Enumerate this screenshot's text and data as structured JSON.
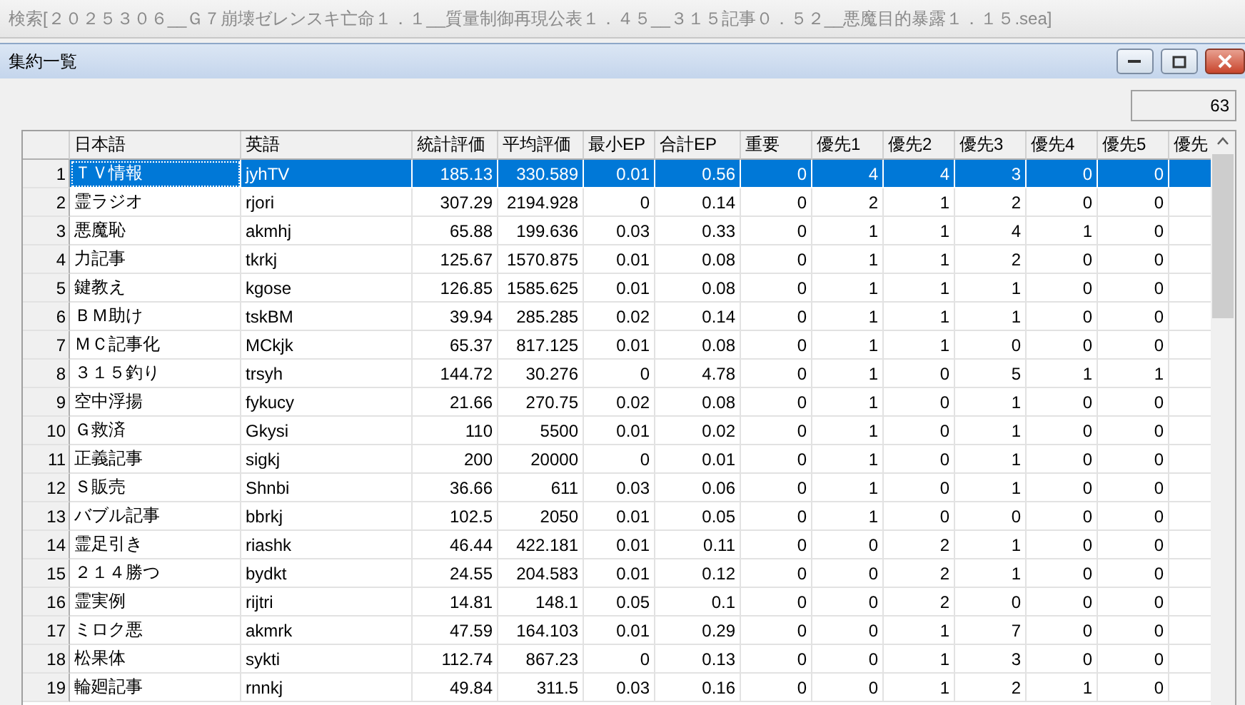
{
  "app_title": "検索[２０２５３０６__Ｇ７崩壊ゼレンスキ亡命１．１__質量制御再現公表１．４５__３１５記事０．５２__悪魔目的暴露１．１５.sea]",
  "window": {
    "title": "集約一覧"
  },
  "count": "63",
  "table": {
    "columns": [
      {
        "label": "日本語",
        "kind": "text"
      },
      {
        "label": "英語",
        "kind": "text"
      },
      {
        "label": "統計評価",
        "kind": "number"
      },
      {
        "label": "平均評価",
        "kind": "number"
      },
      {
        "label": "最小EP",
        "kind": "number"
      },
      {
        "label": "合計EP",
        "kind": "number"
      },
      {
        "label": "重要",
        "kind": "number"
      },
      {
        "label": "優先1",
        "kind": "number"
      },
      {
        "label": "優先2",
        "kind": "number"
      },
      {
        "label": "優先3",
        "kind": "number"
      },
      {
        "label": "優先4",
        "kind": "number"
      },
      {
        "label": "優先5",
        "kind": "number"
      },
      {
        "label": "優先",
        "kind": "number"
      }
    ],
    "rows": [
      {
        "number": "1",
        "selected": true,
        "cells": [
          "ＴＶ情報",
          "jyhTV",
          "185.13",
          "330.589",
          "0.01",
          "0.56",
          "0",
          "4",
          "4",
          "3",
          "0",
          "0"
        ]
      },
      {
        "number": "2",
        "selected": false,
        "cells": [
          "霊ラジオ",
          "rjori",
          "307.29",
          "2194.928",
          "0",
          "0.14",
          "0",
          "2",
          "1",
          "2",
          "0",
          "0"
        ]
      },
      {
        "number": "3",
        "selected": false,
        "cells": [
          "悪魔恥",
          "akmhj",
          "65.88",
          "199.636",
          "0.03",
          "0.33",
          "0",
          "1",
          "1",
          "4",
          "1",
          "0"
        ]
      },
      {
        "number": "4",
        "selected": false,
        "cells": [
          "力記事",
          "tkrkj",
          "125.67",
          "1570.875",
          "0.01",
          "0.08",
          "0",
          "1",
          "1",
          "2",
          "0",
          "0"
        ]
      },
      {
        "number": "5",
        "selected": false,
        "cells": [
          "鍵教え",
          "kgose",
          "126.85",
          "1585.625",
          "0.01",
          "0.08",
          "0",
          "1",
          "1",
          "1",
          "0",
          "0"
        ]
      },
      {
        "number": "6",
        "selected": false,
        "cells": [
          "ＢＭ助け",
          "tskBM",
          "39.94",
          "285.285",
          "0.02",
          "0.14",
          "0",
          "1",
          "1",
          "1",
          "0",
          "0"
        ]
      },
      {
        "number": "7",
        "selected": false,
        "cells": [
          "ＭＣ記事化",
          "MCkjk",
          "65.37",
          "817.125",
          "0.01",
          "0.08",
          "0",
          "1",
          "1",
          "0",
          "0",
          "0"
        ]
      },
      {
        "number": "8",
        "selected": false,
        "cells": [
          "３１５釣り",
          "trsyh",
          "144.72",
          "30.276",
          "0",
          "4.78",
          "0",
          "1",
          "0",
          "5",
          "1",
          "1"
        ]
      },
      {
        "number": "9",
        "selected": false,
        "cells": [
          "空中浮揚",
          "fykucy",
          "21.66",
          "270.75",
          "0.02",
          "0.08",
          "0",
          "1",
          "0",
          "1",
          "0",
          "0"
        ]
      },
      {
        "number": "10",
        "selected": false,
        "cells": [
          "Ｇ救済",
          "Gkysi",
          "110",
          "5500",
          "0.01",
          "0.02",
          "0",
          "1",
          "0",
          "1",
          "0",
          "0"
        ]
      },
      {
        "number": "11",
        "selected": false,
        "cells": [
          "正義記事",
          "sigkj",
          "200",
          "20000",
          "0",
          "0.01",
          "0",
          "1",
          "0",
          "1",
          "0",
          "0"
        ]
      },
      {
        "number": "12",
        "selected": false,
        "cells": [
          "Ｓ販売",
          "Shnbi",
          "36.66",
          "611",
          "0.03",
          "0.06",
          "0",
          "1",
          "0",
          "1",
          "0",
          "0"
        ]
      },
      {
        "number": "13",
        "selected": false,
        "cells": [
          "バブル記事",
          "bbrkj",
          "102.5",
          "2050",
          "0.01",
          "0.05",
          "0",
          "1",
          "0",
          "0",
          "0",
          "0"
        ]
      },
      {
        "number": "14",
        "selected": false,
        "cells": [
          "霊足引き",
          "riashk",
          "46.44",
          "422.181",
          "0.01",
          "0.11",
          "0",
          "0",
          "2",
          "1",
          "0",
          "0"
        ]
      },
      {
        "number": "15",
        "selected": false,
        "cells": [
          "２１４勝つ",
          "bydkt",
          "24.55",
          "204.583",
          "0.01",
          "0.12",
          "0",
          "0",
          "2",
          "1",
          "0",
          "0"
        ]
      },
      {
        "number": "16",
        "selected": false,
        "cells": [
          "霊実例",
          "rijtri",
          "14.81",
          "148.1",
          "0.05",
          "0.1",
          "0",
          "0",
          "2",
          "0",
          "0",
          "0"
        ]
      },
      {
        "number": "17",
        "selected": false,
        "cells": [
          "ミロク悪",
          "akmrk",
          "47.59",
          "164.103",
          "0.01",
          "0.29",
          "0",
          "0",
          "1",
          "7",
          "0",
          "0"
        ]
      },
      {
        "number": "18",
        "selected": false,
        "cells": [
          "松果体",
          "sykti",
          "112.74",
          "867.23",
          "0",
          "0.13",
          "0",
          "0",
          "1",
          "3",
          "0",
          "0"
        ]
      },
      {
        "number": "19",
        "selected": false,
        "cells": [
          "輪廻記事",
          "rnnkj",
          "49.84",
          "311.5",
          "0.03",
          "0.16",
          "0",
          "0",
          "1",
          "2",
          "1",
          "0"
        ]
      }
    ]
  }
}
